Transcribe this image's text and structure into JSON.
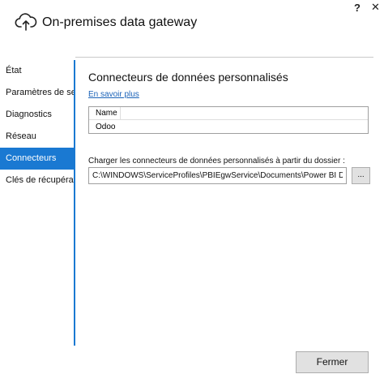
{
  "window": {
    "title": "On-premises data gateway",
    "help_label": "?",
    "close_label": "✕",
    "app_icon": "cloud-upload-icon"
  },
  "sidebar": {
    "items": [
      {
        "label": "État",
        "active": false
      },
      {
        "label": "Paramètres de service",
        "active": false
      },
      {
        "label": "Diagnostics",
        "active": false
      },
      {
        "label": "Réseau",
        "active": false
      },
      {
        "label": "Connecteurs",
        "active": true
      },
      {
        "label": "Clés de récupération",
        "active": false
      }
    ],
    "accent_color": "#1a79d2"
  },
  "main": {
    "title": "Connecteurs de données personnalisés",
    "learn_more": "En savoir plus",
    "connectors_table": {
      "columns": [
        "Name"
      ],
      "rows": [
        [
          "Odoo"
        ]
      ]
    },
    "folder_label": "Charger les connecteurs de données personnalisés à partir du dossier :",
    "folder_path": "C:\\WINDOWS\\ServiceProfiles\\PBIEgwService\\Documents\\Power BI Desktop\\Custom Connectors",
    "browse_label": "..."
  },
  "footer": {
    "close_button": "Fermer"
  }
}
